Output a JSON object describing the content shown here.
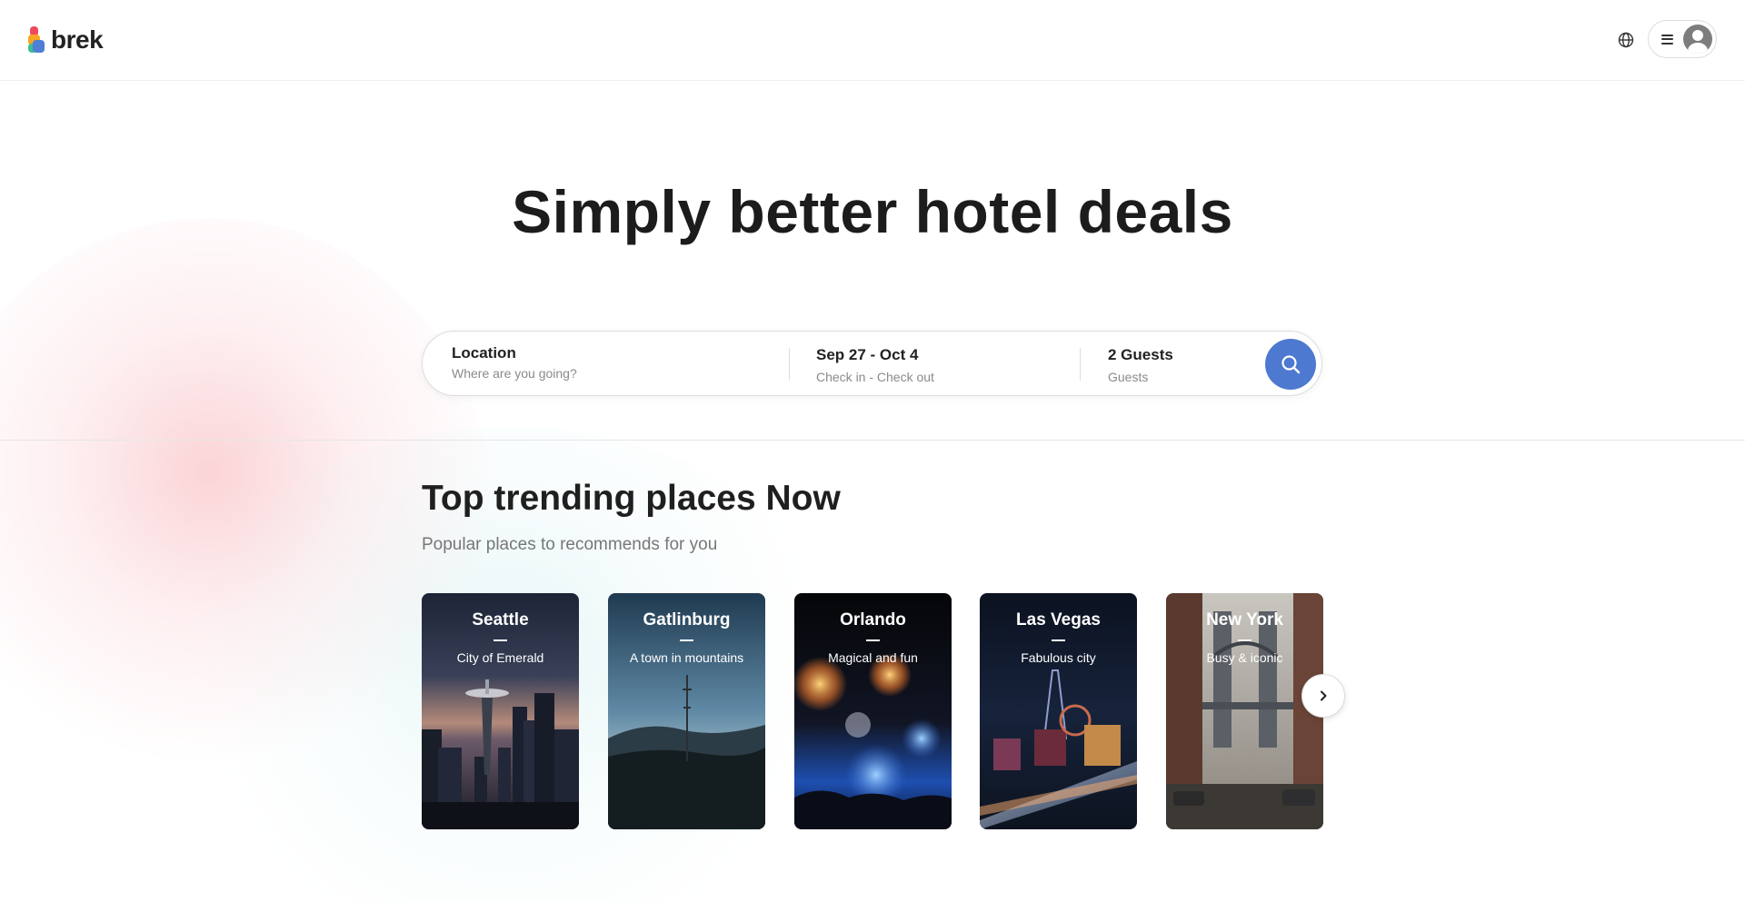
{
  "header": {
    "brand": "brek",
    "globe_icon": "globe-icon",
    "menu_icon": "hamburger-menu-icon",
    "avatar_icon": "user-avatar-icon"
  },
  "hero": {
    "title": "Simply better hotel deals"
  },
  "search": {
    "location_label": "Location",
    "location_placeholder": "Where are you going?",
    "dates_value": "Sep 27 - Oct 4",
    "dates_sub": "Check in - Check out",
    "guests_value": "2 Guests",
    "guests_sub": "Guests",
    "button_icon": "search-icon",
    "button_color": "#4d79d1"
  },
  "trending": {
    "title": "Top trending places Now",
    "subtitle": "Popular places to recommends for you",
    "cards": [
      {
        "city": "Seattle",
        "tagline": "City of Emerald"
      },
      {
        "city": "Gatlinburg",
        "tagline": "A town in mountains"
      },
      {
        "city": "Orlando",
        "tagline": "Magical and fun"
      },
      {
        "city": "Las Vegas",
        "tagline": "Fabulous city"
      },
      {
        "city": "New York",
        "tagline": "Busy & iconic"
      }
    ],
    "next_icon": "chevron-right-icon"
  },
  "colors": {
    "accent": "#4d79d1",
    "logo_red": "#ef4a5c",
    "logo_orange": "#f6a623",
    "logo_blue": "#4d7fd6",
    "logo_green": "#3bbf8f"
  }
}
